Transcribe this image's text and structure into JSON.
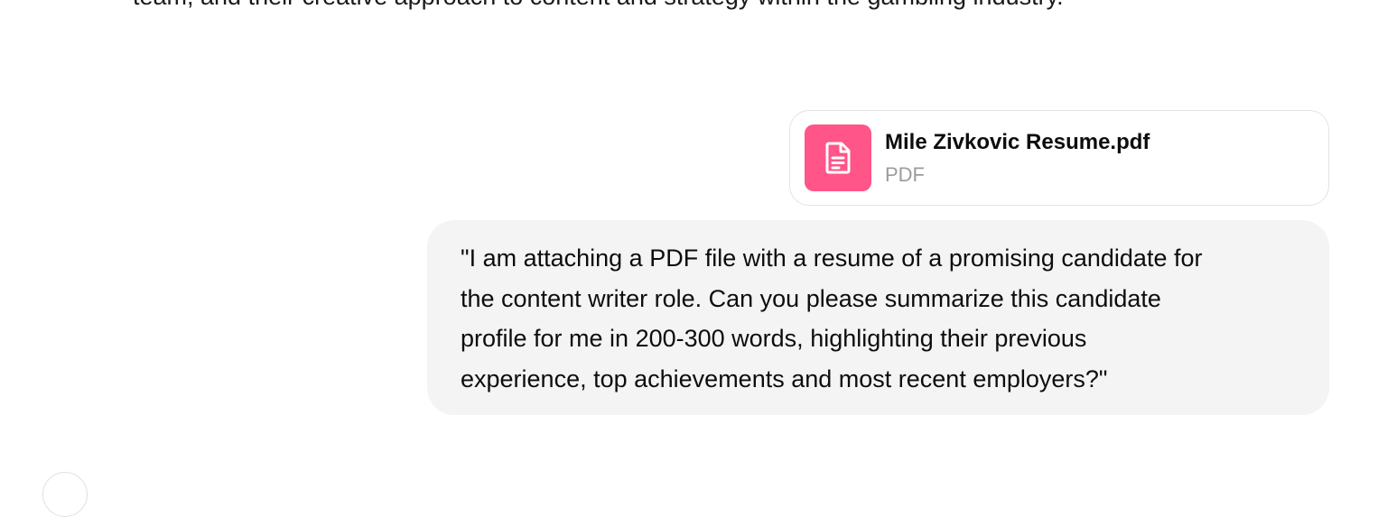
{
  "previous_message": {
    "text": "team, and their creative approach to content and strategy within the gambling industry."
  },
  "attachment": {
    "file_name": "Mile Zivkovic Resume.pdf",
    "file_type": "PDF",
    "icon": "document-icon",
    "icon_color": "#ff5588"
  },
  "user_message": {
    "lines": [
      "\"I am attaching a PDF file with a resume of a promising candidate for",
      "the content writer role. Can you please summarize this candidate",
      "profile for me in 200-300 words, highlighting their previous",
      "experience, top achievements and most recent employers?\""
    ]
  }
}
